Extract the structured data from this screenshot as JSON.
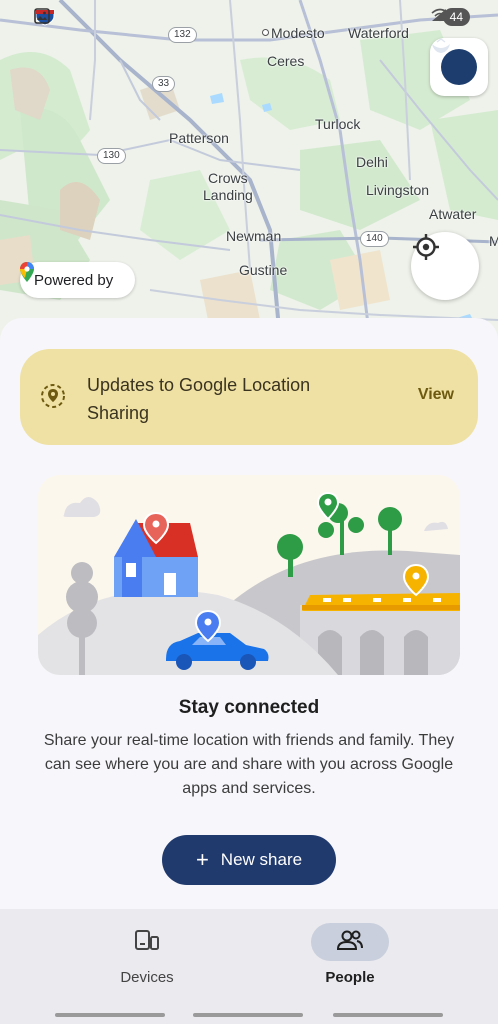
{
  "status_bar": {
    "left_text": "1",
    "battery": "44"
  },
  "map": {
    "places": [
      {
        "name": "Modesto"
      },
      {
        "name": "Waterford"
      },
      {
        "name": "Ceres"
      },
      {
        "name": "Turlock"
      },
      {
        "name": "Patterson"
      },
      {
        "name": "Delhi"
      },
      {
        "name": "Crows"
      },
      {
        "name": "Landing"
      },
      {
        "name": "Livingston"
      },
      {
        "name": "Atwater"
      },
      {
        "name": "Newman"
      },
      {
        "name": "Gustine"
      },
      {
        "name": "M"
      }
    ],
    "highways": [
      "132",
      "33",
      "130",
      "140"
    ],
    "powered_by": "Powered by"
  },
  "banner": {
    "text": "Updates to Google Location Sharing",
    "action": "View"
  },
  "content": {
    "title": "Stay connected",
    "description": "Share your real-time location with friends and family. They can see where you are and share with you across Google apps and services.",
    "new_share": "New share"
  },
  "nav": {
    "items": [
      {
        "label": "Devices",
        "active": false
      },
      {
        "label": "People",
        "active": true
      }
    ]
  },
  "colors": {
    "accent": "#203a6e",
    "banner_bg": "#efe1a3",
    "map_bg": "#eef2ea"
  }
}
